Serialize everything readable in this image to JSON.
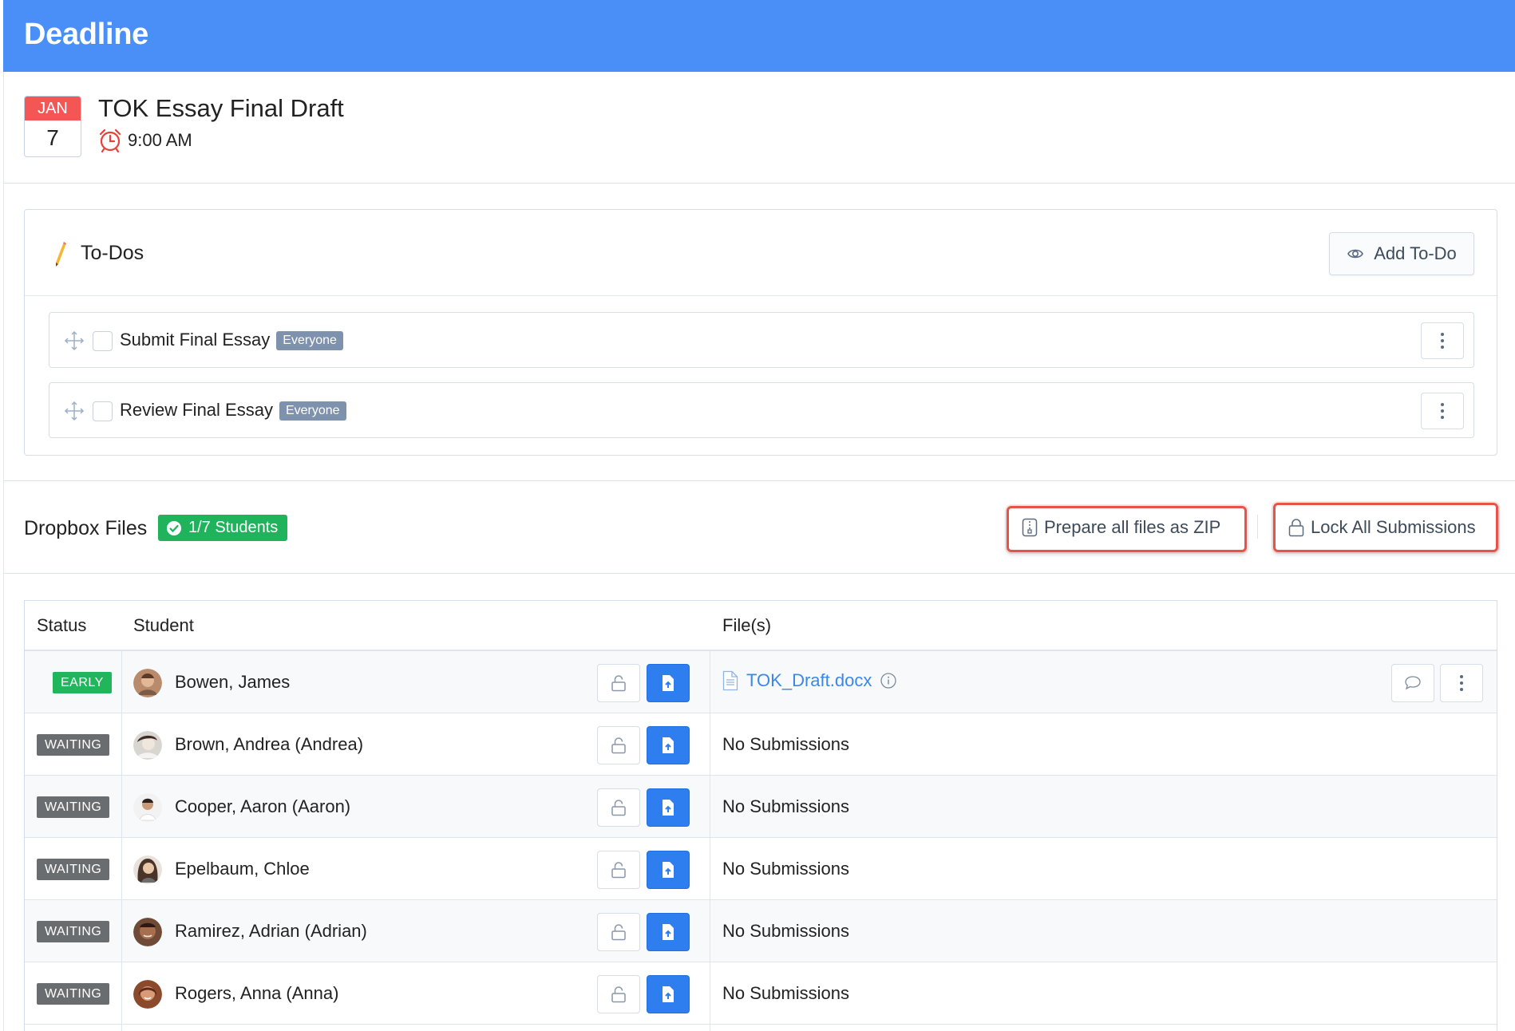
{
  "app": {
    "title": "Deadline"
  },
  "deadline": {
    "month": "JAN",
    "day": "7",
    "title": "TOK Essay Final Draft",
    "time": "9:00 AM"
  },
  "todos": {
    "title": "To-Dos",
    "add_label": "Add To-Do",
    "items": [
      {
        "label": "Submit Final Essay",
        "tag": "Everyone"
      },
      {
        "label": "Review Final Essay",
        "tag": "Everyone"
      }
    ]
  },
  "dropbox": {
    "title": "Dropbox Files",
    "badge": "1/7 Students",
    "zip_label": "Prepare all files as ZIP",
    "lock_label": "Lock All Submissions",
    "columns": [
      "Status",
      "Student",
      "File(s)"
    ],
    "rows": [
      {
        "status": "EARLY",
        "student": "Bowen, James",
        "file": "TOK_Draft.docx"
      },
      {
        "status": "WAITING",
        "student": "Brown, Andrea (Andrea)",
        "file": "No Submissions"
      },
      {
        "status": "WAITING",
        "student": "Cooper, Aaron (Aaron)",
        "file": "No Submissions"
      },
      {
        "status": "WAITING",
        "student": "Epelbaum, Chloe",
        "file": "No Submissions"
      },
      {
        "status": "WAITING",
        "student": "Ramirez, Adrian (Adrian)",
        "file": "No Submissions"
      },
      {
        "status": "WAITING",
        "student": "Rogers, Anna (Anna)",
        "file": "No Submissions"
      }
    ]
  },
  "colors": {
    "header": "#4a8ff7",
    "early": "#21b65c",
    "waiting": "#6a6d70",
    "primary_button": "#2e7ef0",
    "highlight": "#e6534b",
    "calendar_month": "#f45555"
  }
}
